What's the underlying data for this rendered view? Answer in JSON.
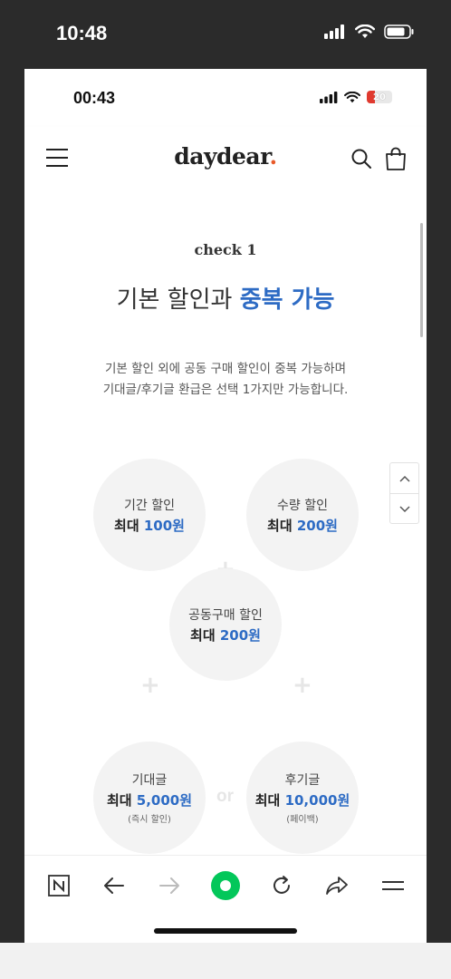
{
  "outer_status": {
    "time": "10:48"
  },
  "inner_status": {
    "time": "00:43",
    "battery": "20"
  },
  "header": {
    "logo_text": "daydear",
    "logo_dot": "."
  },
  "section": {
    "check_label": "check 1",
    "title_plain": "기본 할인과 ",
    "title_highlight": "중복 가능",
    "desc_line1": "기본 할인 외에 공동 구매 할인이 중복 가능하며",
    "desc_line2": "기대글/후기글 환급은 선택 1가지만 가능합니다."
  },
  "circles": {
    "period": {
      "label": "기간 할인",
      "prefix": "최대 ",
      "amount": "100원"
    },
    "quantity": {
      "label": "수량 할인",
      "prefix": "최대 ",
      "amount": "200원"
    },
    "group": {
      "label": "공동구매 할인",
      "prefix": "최대 ",
      "amount": "200원"
    },
    "expect": {
      "label": "기대글",
      "prefix": "최대 ",
      "amount": "5,000원",
      "note": "(즉시 할인)"
    },
    "review": {
      "label": "후기글",
      "prefix": "최대 ",
      "amount": "10,000원",
      "note": "(페이백)"
    }
  },
  "symbols": {
    "plus": "+",
    "or": "or"
  },
  "colors": {
    "accent": "#2d6bc4",
    "logo_dot": "#e85a2a",
    "naver_green": "#03c75a"
  },
  "icons": {
    "toolbar": [
      "naver-n-icon",
      "back-arrow-icon",
      "forward-arrow-icon",
      "green-dot-icon",
      "refresh-icon",
      "share-icon",
      "menu-icon"
    ]
  }
}
